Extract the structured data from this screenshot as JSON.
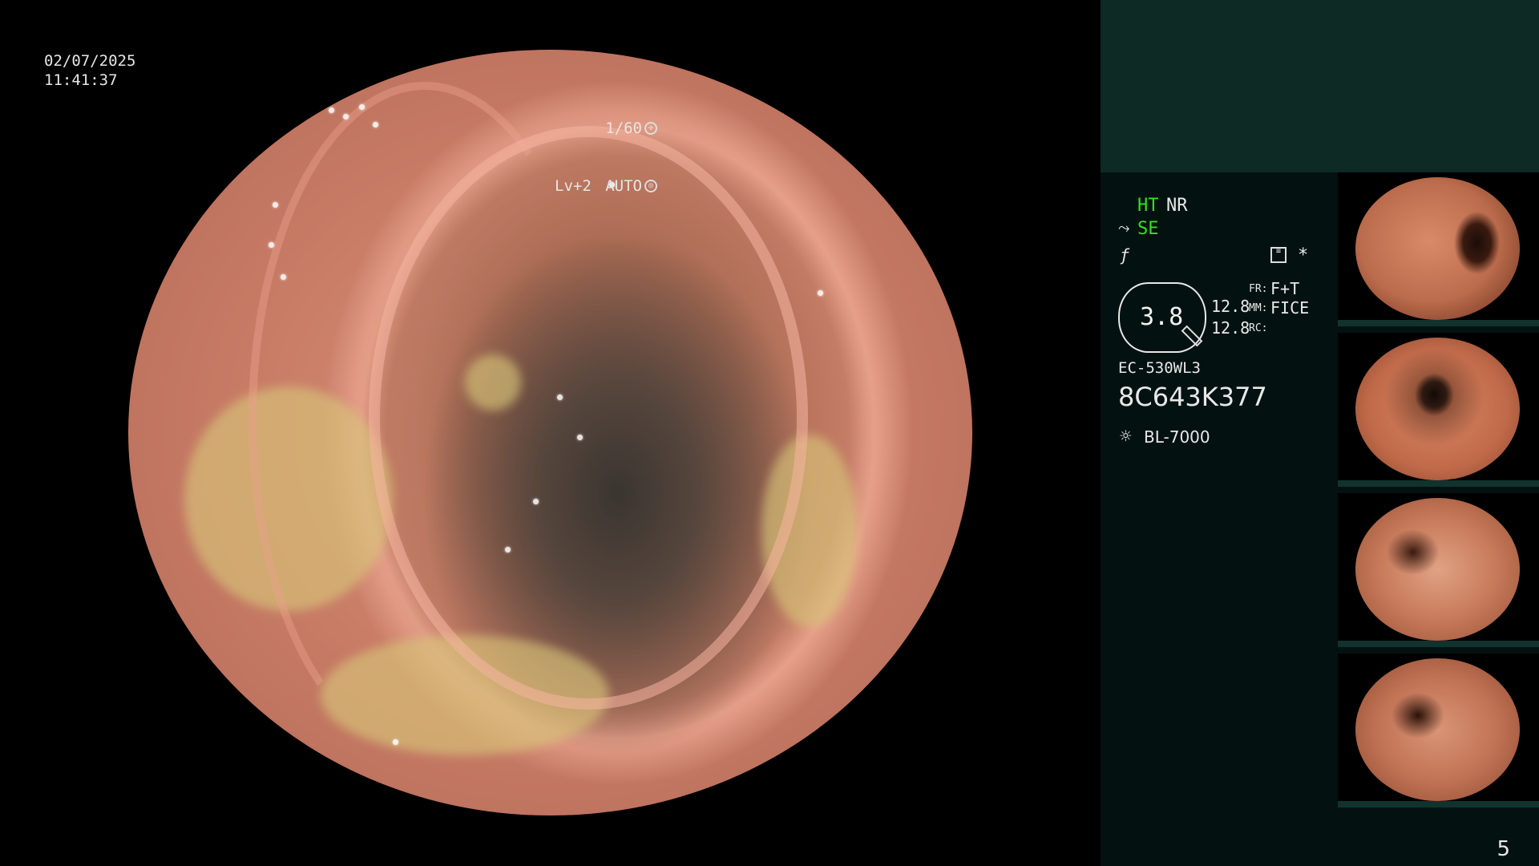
{
  "overlay": {
    "date": "02/07/2025",
    "time": "11:41:37",
    "shutter_speed": "1/60",
    "level": "Lv+2",
    "exposure_mode": "AUTO"
  },
  "panel": {
    "mode_ht": "HT",
    "mode_nr": "NR",
    "mode_se": "SE",
    "gauge_value": "3.8",
    "value_1": "12.8",
    "value_2": "12.8",
    "fr_label": "FR:",
    "fr_value": "F+T",
    "mm_label": "MM:",
    "mm_value": "FICE",
    "rc_label": "RC:",
    "scope_model": "EC-530WL3",
    "serial": "8C643K377",
    "light_source": "BL-7000",
    "page_number": "5"
  },
  "colors": {
    "panel_bg": "#031210",
    "panel_top": "#0d2a25",
    "active_mode": "#35e020"
  }
}
